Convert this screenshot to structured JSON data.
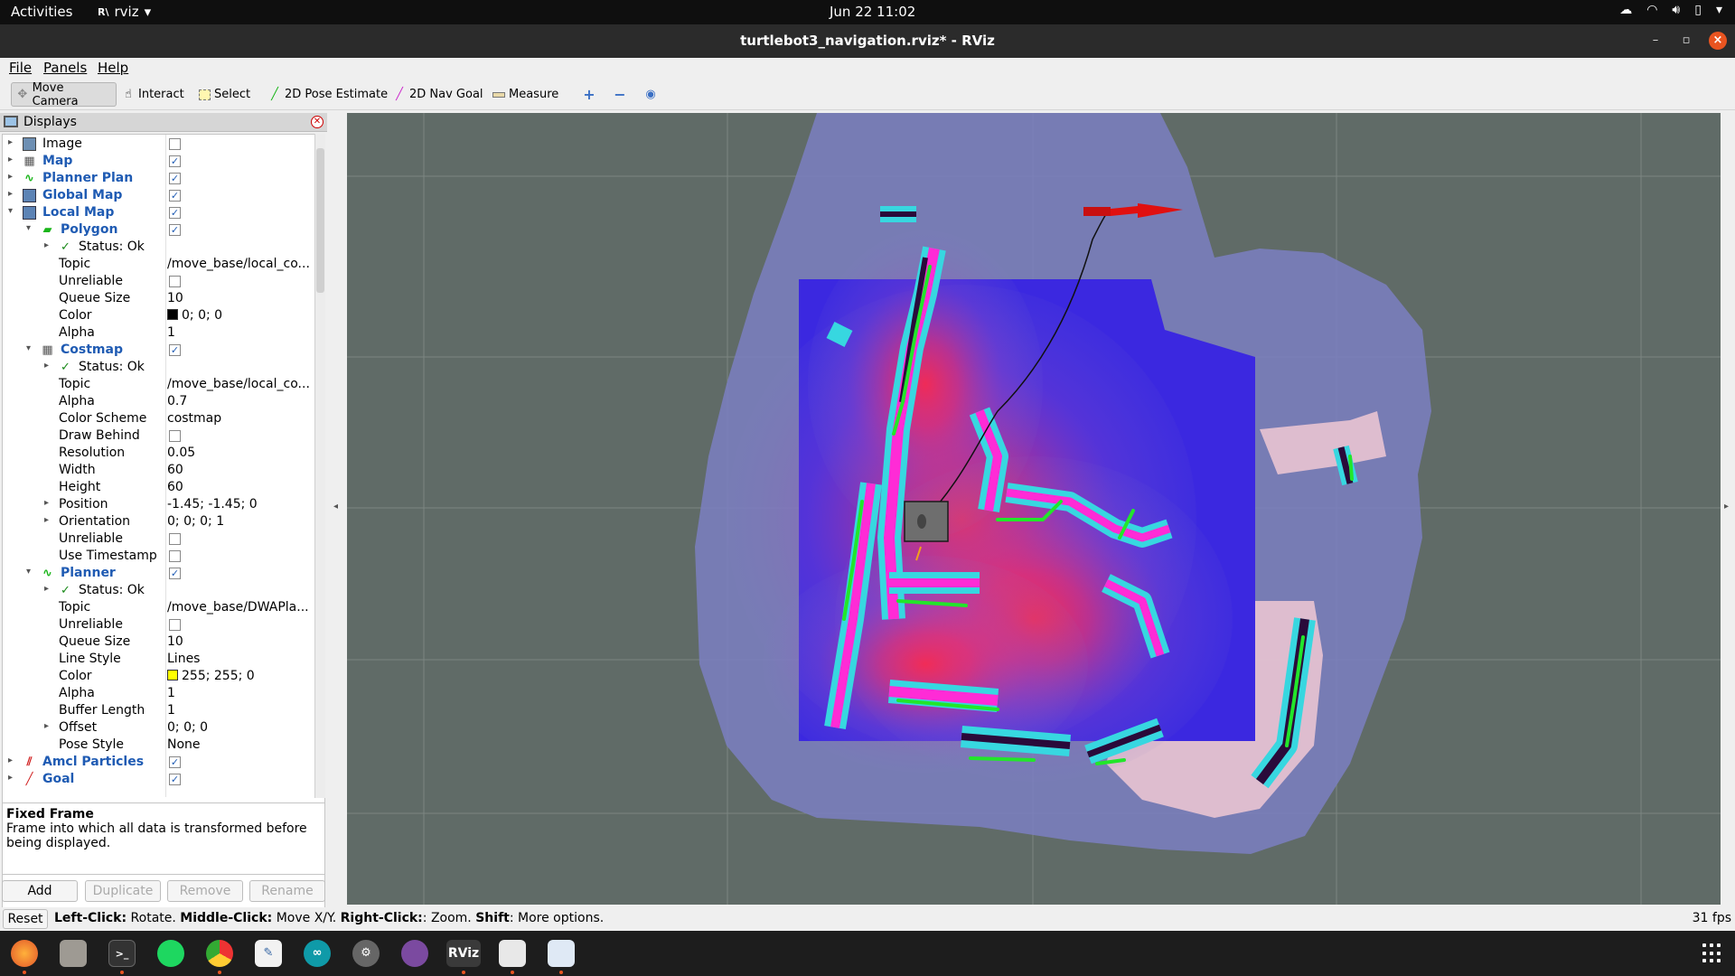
{
  "topbar": {
    "activities": "Activities",
    "app": "rviz",
    "clock": "Jun 22  11:02"
  },
  "window": {
    "title": "turtlebot3_navigation.rviz* - RViz"
  },
  "menu": [
    "File",
    "Panels",
    "Help"
  ],
  "toolbar": {
    "move_camera": "Move Camera",
    "interact": "Interact",
    "select": "Select",
    "pose_estimate": "2D Pose Estimate",
    "nav_goal": "2D Nav Goal",
    "measure": "Measure"
  },
  "displays": {
    "title": "Displays",
    "rows": [
      {
        "name": "Image",
        "type": "display"
      },
      {
        "name": "Map",
        "type": "display"
      },
      {
        "name": "Planner Plan",
        "type": "display"
      },
      {
        "name": "Global Map",
        "type": "display"
      },
      {
        "name": "Local Map",
        "type": "display"
      },
      {
        "name": "Polygon",
        "type": "display"
      },
      {
        "name": "Status: Ok",
        "type": "status"
      },
      {
        "name": "Topic",
        "value": "/move_base/local_co..."
      },
      {
        "name": "Unreliable"
      },
      {
        "name": "Queue Size",
        "value": "10"
      },
      {
        "name": "Color",
        "value": "0; 0; 0",
        "color": "#000000"
      },
      {
        "name": "Alpha",
        "value": "1"
      },
      {
        "name": "Costmap",
        "type": "display"
      },
      {
        "name": "Status: Ok",
        "type": "status"
      },
      {
        "name": "Topic",
        "value": "/move_base/local_co..."
      },
      {
        "name": "Alpha",
        "value": "0.7"
      },
      {
        "name": "Color Scheme",
        "value": "costmap"
      },
      {
        "name": "Draw Behind"
      },
      {
        "name": "Resolution",
        "value": "0.05"
      },
      {
        "name": "Width",
        "value": "60"
      },
      {
        "name": "Height",
        "value": "60"
      },
      {
        "name": "Position",
        "value": "-1.45; -1.45; 0"
      },
      {
        "name": "Orientation",
        "value": "0; 0; 0; 1"
      },
      {
        "name": "Unreliable"
      },
      {
        "name": "Use Timestamp"
      },
      {
        "name": "Planner",
        "type": "display"
      },
      {
        "name": "Status: Ok",
        "type": "status"
      },
      {
        "name": "Topic",
        "value": "/move_base/DWAPla..."
      },
      {
        "name": "Unreliable"
      },
      {
        "name": "Queue Size",
        "value": "10"
      },
      {
        "name": "Line Style",
        "value": "Lines"
      },
      {
        "name": "Color",
        "value": "255; 255; 0",
        "color": "#ffff00"
      },
      {
        "name": "Alpha",
        "value": "1"
      },
      {
        "name": "Buffer Length",
        "value": "1"
      },
      {
        "name": "Offset",
        "value": "0; 0; 0"
      },
      {
        "name": "Pose Style",
        "value": "None"
      },
      {
        "name": "Amcl Particles",
        "type": "display"
      },
      {
        "name": "Goal",
        "type": "display"
      }
    ]
  },
  "description": {
    "heading": "Fixed Frame",
    "text": "Frame into which all data is transformed before being displayed."
  },
  "buttons": {
    "add": "Add",
    "duplicate": "Duplicate",
    "remove": "Remove",
    "rename": "Rename"
  },
  "status": {
    "reset": "Reset",
    "left_click": "Left-Click:",
    "left_text": " Rotate. ",
    "middle_click": "Middle-Click:",
    "middle_text": " Move X/Y. ",
    "right_click": "Right-Click:",
    "right_text": ": Zoom. ",
    "shift": "Shift",
    "shift_text": ": More options.",
    "fps": "31 fps"
  },
  "dock": {
    "rviz_label": "RViz"
  },
  "colors": {
    "accent": "#e95420",
    "link": "#1f5bb3",
    "view_bg": "#606b67"
  }
}
